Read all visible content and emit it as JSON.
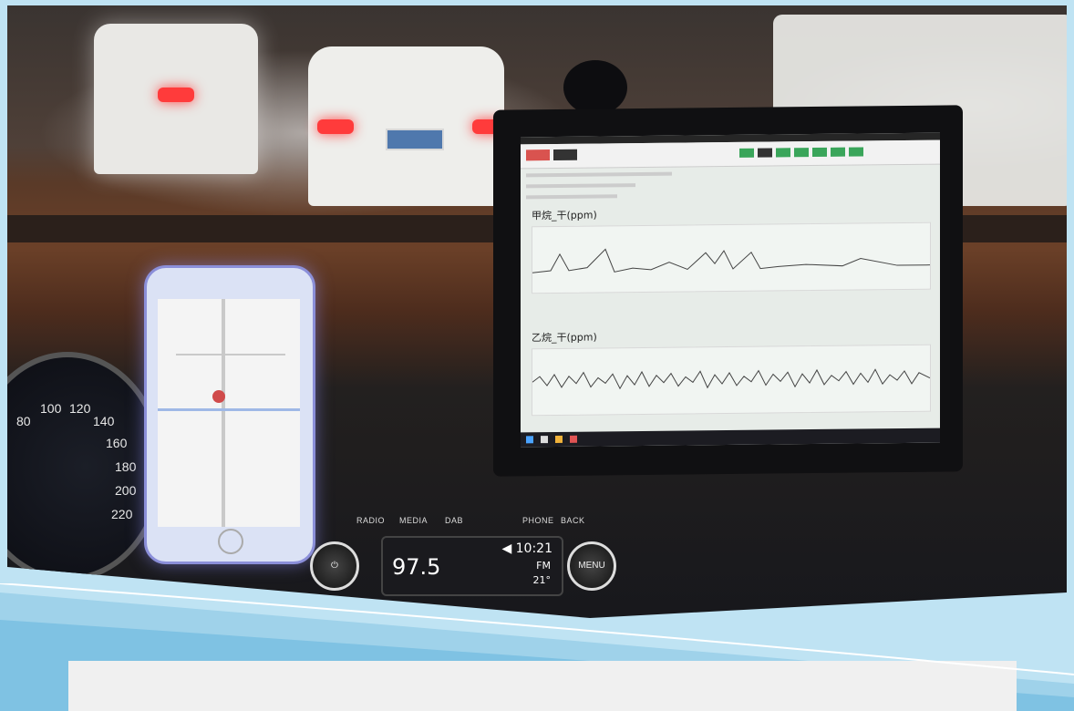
{
  "scene": {
    "radio": {
      "frequency": "97.5",
      "volume_time": "◀ 10:21",
      "band": "FM",
      "temperature": "21°",
      "knob_label": "MENU",
      "buttons": [
        "RADIO",
        "MEDIA",
        "DAB",
        "PHONE",
        "BACK"
      ]
    },
    "gauge": {
      "numbers": [
        "80",
        "100",
        "120",
        "140",
        "160",
        "180",
        "200",
        "220"
      ]
    },
    "tablet": {
      "chart1_title": "甲烷_干(ppm)",
      "chart2_title": "乙烷_干(ppm)"
    }
  },
  "colors": {
    "frame_bg": "#bfe3f3",
    "accent_green": "#3aa55a",
    "accent_red": "#d9534f"
  }
}
